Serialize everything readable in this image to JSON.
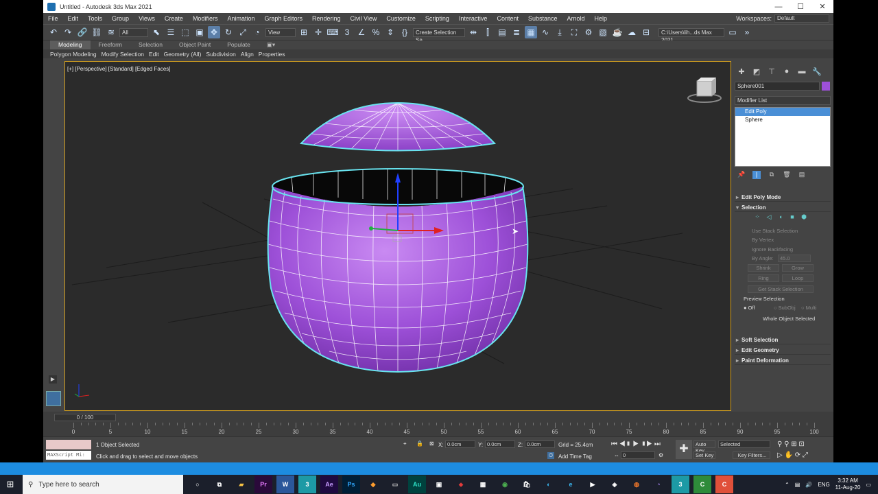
{
  "window": {
    "title": "Untitled - Autodesk 3ds Max 2021",
    "min_label": "—",
    "max_label": "☐",
    "close_label": "✕"
  },
  "menu": [
    "File",
    "Edit",
    "Tools",
    "Group",
    "Views",
    "Create",
    "Modifiers",
    "Animation",
    "Graph Editors",
    "Rendering",
    "Civil View",
    "Customize",
    "Scripting",
    "Interactive",
    "Content",
    "Substance",
    "Arnold",
    "Help"
  ],
  "workspace": {
    "label": "Workspaces:",
    "value": "Default"
  },
  "toolbar": {
    "filter": "All",
    "refcoord": "View",
    "selset": "Create Selection Se",
    "path": "C:\\Users\\lih...ds Max 2021"
  },
  "ribbon_tabs": [
    "Modeling",
    "Freeform",
    "Selection",
    "Object Paint",
    "Populate"
  ],
  "ribbon_sub": [
    "Polygon Modeling",
    "Modify Selection",
    "Edit",
    "Geometry (All)",
    "Subdivision",
    "Align",
    "Properties"
  ],
  "viewport": {
    "label": "[+] [Perspective] [Standard] [Edged Faces]"
  },
  "colors": {
    "object": "#9d50d8",
    "selection_outline": "#69e3ef",
    "active_border": "#d6a21f"
  },
  "command_panel": {
    "object_name": "Sphere001",
    "modifier_list": "Modifier List",
    "stack": [
      "Edit Poly",
      "Sphere"
    ],
    "rollouts": {
      "edit_poly_mode": "Edit Poly Mode",
      "selection": "Selection",
      "soft_selection": "Soft Selection",
      "edit_geometry": "Edit Geometry",
      "paint_deformation": "Paint Deformation"
    },
    "selection": {
      "use_stack": "Use Stack Selection",
      "by_vertex": "By Vertex",
      "ignore_backfacing": "Ignore Backfacing",
      "by_angle": "By Angle:",
      "angle_value": "45.0",
      "shrink": "Shrink",
      "grow": "Grow",
      "ring": "Ring",
      "loop": "Loop",
      "get_stack": "Get Stack Selection",
      "preview_label": "Preview Selection",
      "preview_off": "Off",
      "preview_subobj": "SubObj",
      "preview_multi": "Multi",
      "whole_object": "Whole Object Selected"
    }
  },
  "timeline": {
    "slider": "0 / 100",
    "ticks": [
      "0",
      "5",
      "10",
      "15",
      "20",
      "25",
      "30",
      "35",
      "40",
      "45",
      "50",
      "55",
      "60",
      "65",
      "70",
      "75",
      "80",
      "85",
      "90",
      "95",
      "100"
    ]
  },
  "status": {
    "maxscript": "MAXScript Mi:",
    "selected": "1 Object Selected",
    "prompt": "Click and drag to select and move objects",
    "x_label": "X:",
    "x": "0.0cm",
    "y_label": "Y:",
    "y": "0.0cm",
    "z_label": "Z:",
    "z": "0.0cm",
    "grid": "Grid = 25.4cm",
    "add_time_tag": "Add Time Tag",
    "auto_key": "Auto Key",
    "set_key": "Set Key",
    "key_mode": "Selected",
    "key_filters": "Key Filters...",
    "frame": "0"
  },
  "taskbar": {
    "search_placeholder": "Type here to search",
    "lang": "ENG",
    "time": "3:32 AM",
    "date": "11-Aug-20",
    "apps": [
      "Pr",
      "W",
      "3",
      "Ae",
      "Ps",
      "Au"
    ]
  }
}
